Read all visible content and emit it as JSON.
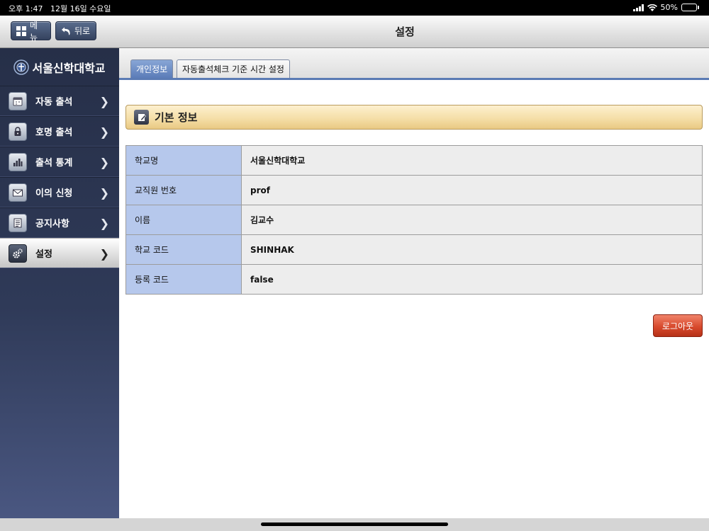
{
  "status_bar": {
    "time": "오후 1:47",
    "date": "12월 16일 수요일",
    "battery": "50%",
    "battery_level": 0.5
  },
  "header": {
    "title": "설정",
    "menu_label": "메뉴",
    "back_label": "뒤로"
  },
  "sidebar": {
    "logo_text": "서울신학대학교",
    "items": [
      {
        "label": "자동 출석",
        "icon": "calendar-icon"
      },
      {
        "label": "호명 출석",
        "icon": "lock-icon"
      },
      {
        "label": "출석 통계",
        "icon": "bar-chart-icon"
      },
      {
        "label": "이의 신청",
        "icon": "mail-icon"
      },
      {
        "label": "공지사항",
        "icon": "list-icon"
      },
      {
        "label": "설정",
        "icon": "gear-icon",
        "active": true
      }
    ]
  },
  "tabs": [
    {
      "label": "개인정보",
      "active": true
    },
    {
      "label": "자동출석체크 기준 시간 설정",
      "active": false
    }
  ],
  "section": {
    "title": "기본 정보"
  },
  "info_rows": [
    {
      "key": "학교명",
      "value": "서울신학대학교"
    },
    {
      "key": "교직원 번호",
      "value": "prof"
    },
    {
      "key": "이름",
      "value": "김교수"
    },
    {
      "key": "학교 코드",
      "value": "SHINHAK"
    },
    {
      "key": "등록 코드",
      "value": "false"
    }
  ],
  "logout_label": "로그아웃",
  "colors": {
    "accent": "#5b7bb4",
    "sidebar": "#2f3a58",
    "logout": "#d84a2d",
    "section": "#f5dfa8"
  }
}
